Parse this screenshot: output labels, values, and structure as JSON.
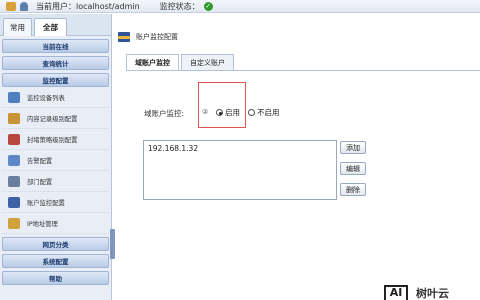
{
  "header": {
    "user_label": "当前用户：localhost/admin",
    "status_label": "监控状态：",
    "status_icon": "check-circle-icon"
  },
  "sidebar": {
    "tabs": [
      {
        "label": "常用",
        "active": false
      },
      {
        "label": "全部",
        "active": true
      }
    ],
    "sections_top": [
      "当前在线",
      "查询统计",
      "监控配置"
    ],
    "items": [
      {
        "label": "监控设备列表",
        "icon": "device-list-icon",
        "color": "#4f7fc0"
      },
      {
        "label": "内容记录级别配置",
        "icon": "content-record-icon",
        "color": "#c89236"
      },
      {
        "label": "封堵策略级别配置",
        "icon": "block-policy-icon",
        "color": "#b8473c"
      },
      {
        "label": "告警配置",
        "icon": "alarm-icon",
        "color": "#5c88c8"
      },
      {
        "label": "部门配置",
        "icon": "department-icon",
        "color": "#6b7f9e"
      },
      {
        "label": "账户监控配置",
        "icon": "account-monitor-icon",
        "color": "#3d62a6"
      },
      {
        "label": "IP地址管理",
        "icon": "ip-manage-icon",
        "color": "#d1a23c"
      }
    ],
    "sections_bottom": [
      "网页分类",
      "系统配置",
      "帮助"
    ]
  },
  "main": {
    "title": "账户监控配置",
    "tabs": [
      {
        "label": "域账户监控",
        "active": true
      },
      {
        "label": "自定义账户",
        "active": false
      }
    ],
    "monitor_label": "域账户监控:",
    "help_mark": "②",
    "radio_on_label": "启用",
    "radio_off_label": "不启用",
    "radio_selected": "启用",
    "ip_list": [
      "192.168.1.32"
    ],
    "buttons": {
      "add": "添加",
      "edit": "编辑",
      "delete": "删除"
    }
  },
  "watermark": {
    "box": "AI",
    "text": "树叶云"
  },
  "colors": {
    "accent": "#2f5597",
    "highlight_border": "#e05454",
    "status_ok": "#2e9a2e"
  }
}
